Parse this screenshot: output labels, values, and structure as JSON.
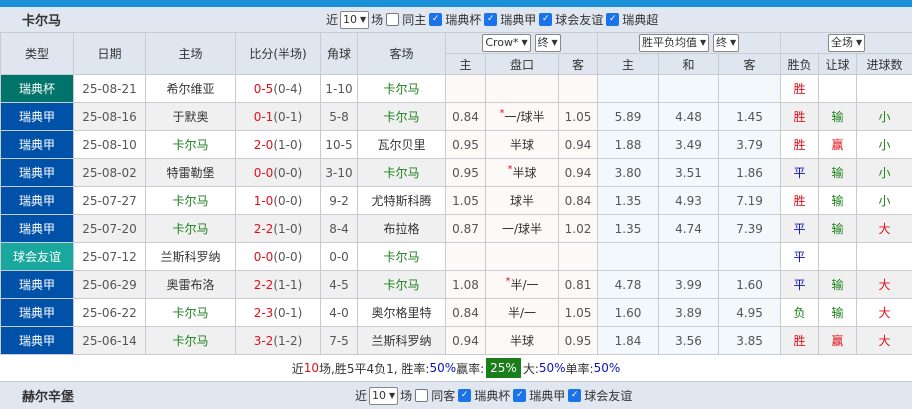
{
  "home_team": {
    "name": "卡尔马",
    "filter": {
      "near": "近",
      "count": "10",
      "unit": "场",
      "same": "同主",
      "leagues": [
        "瑞典杯",
        "瑞典甲",
        "球会友谊",
        "瑞典超"
      ]
    }
  },
  "headers": {
    "type": "类型",
    "date": "日期",
    "home": "主场",
    "score": "比分(半场)",
    "corner": "角球",
    "away": "客场",
    "company": "Crow*",
    "final1": "终",
    "odds_type": "胜平负均值",
    "final2": "终",
    "scope": "全场",
    "sub": [
      "主",
      "盘口",
      "客",
      "主",
      "和",
      "客",
      "胜负",
      "让球",
      "进球数"
    ]
  },
  "league_colors": {
    "瑞典杯": "#00736a",
    "瑞典甲": "#0051a8",
    "球会友谊": "#1aa89e"
  },
  "rows": [
    {
      "league": "瑞典杯",
      "date": "25-08-21",
      "home": "希尔维亚",
      "home_hl": false,
      "ft": "0-5",
      "ht": "(0-4)",
      "corner": "1-10",
      "away": "卡尔马",
      "away_hl": true,
      "ah_h": "",
      "ah": "",
      "ah_star": false,
      "ah_a": "",
      "w": "",
      "d": "",
      "l": "",
      "res": "胜",
      "hc": "",
      "ou": ""
    },
    {
      "league": "瑞典甲",
      "date": "25-08-16",
      "home": "于默奥",
      "home_hl": false,
      "ft": "0-1",
      "ht": "(0-1)",
      "corner": "5-8",
      "away": "卡尔马",
      "away_hl": true,
      "ah_h": "0.84",
      "ah": "一/球半",
      "ah_star": true,
      "ah_a": "1.05",
      "w": "5.89",
      "d": "4.48",
      "l": "1.45",
      "res": "胜",
      "hc": "输",
      "ou": "小"
    },
    {
      "league": "瑞典甲",
      "date": "25-08-10",
      "home": "卡尔马",
      "home_hl": true,
      "ft": "2-0",
      "ht": "(1-0)",
      "corner": "10-5",
      "away": "瓦尔贝里",
      "away_hl": false,
      "ah_h": "0.95",
      "ah": "半球",
      "ah_star": false,
      "ah_a": "0.94",
      "w": "1.88",
      "d": "3.49",
      "l": "3.79",
      "res": "胜",
      "hc": "赢",
      "ou": "小"
    },
    {
      "league": "瑞典甲",
      "date": "25-08-02",
      "home": "特雷勒堡",
      "home_hl": false,
      "ft": "0-0",
      "ht": "(0-0)",
      "corner": "3-10",
      "away": "卡尔马",
      "away_hl": true,
      "ah_h": "0.95",
      "ah": "半球",
      "ah_star": true,
      "ah_a": "0.94",
      "w": "3.80",
      "d": "3.51",
      "l": "1.86",
      "res": "平",
      "hc": "输",
      "ou": "小"
    },
    {
      "league": "瑞典甲",
      "date": "25-07-27",
      "home": "卡尔马",
      "home_hl": true,
      "ft": "1-0",
      "ht": "(0-0)",
      "corner": "9-2",
      "away": "尤特斯科腾",
      "away_hl": false,
      "ah_h": "1.05",
      "ah": "球半",
      "ah_star": false,
      "ah_a": "0.84",
      "w": "1.35",
      "d": "4.93",
      "l": "7.19",
      "res": "胜",
      "hc": "输",
      "ou": "小"
    },
    {
      "league": "瑞典甲",
      "date": "25-07-20",
      "home": "卡尔马",
      "home_hl": true,
      "ft": "2-2",
      "ht": "(1-0)",
      "corner": "8-4",
      "away": "布拉格",
      "away_hl": false,
      "ah_h": "0.87",
      "ah": "一/球半",
      "ah_star": false,
      "ah_a": "1.02",
      "w": "1.35",
      "d": "4.74",
      "l": "7.39",
      "res": "平",
      "hc": "输",
      "ou": "大"
    },
    {
      "league": "球会友谊",
      "date": "25-07-12",
      "home": "兰斯科罗纳",
      "home_hl": false,
      "ft": "0-0",
      "ht": "(0-0)",
      "corner": "0-0",
      "away": "卡尔马",
      "away_hl": true,
      "ah_h": "",
      "ah": "",
      "ah_star": false,
      "ah_a": "",
      "w": "",
      "d": "",
      "l": "",
      "res": "平",
      "hc": "",
      "ou": ""
    },
    {
      "league": "瑞典甲",
      "date": "25-06-29",
      "home": "奥雷布洛",
      "home_hl": false,
      "ft": "2-2",
      "ht": "(1-1)",
      "corner": "4-5",
      "away": "卡尔马",
      "away_hl": true,
      "ah_h": "1.08",
      "ah": "半/一",
      "ah_star": true,
      "ah_a": "0.81",
      "w": "4.78",
      "d": "3.99",
      "l": "1.60",
      "res": "平",
      "hc": "输",
      "ou": "大"
    },
    {
      "league": "瑞典甲",
      "date": "25-06-22",
      "home": "卡尔马",
      "home_hl": true,
      "ft": "2-3",
      "ht": "(0-1)",
      "corner": "4-0",
      "away": "奥尔格里特",
      "away_hl": false,
      "ah_h": "0.84",
      "ah": "半/一",
      "ah_star": false,
      "ah_a": "1.05",
      "w": "1.60",
      "d": "3.89",
      "l": "4.95",
      "res": "负",
      "hc": "输",
      "ou": "大"
    },
    {
      "league": "瑞典甲",
      "date": "25-06-14",
      "home": "卡尔马",
      "home_hl": true,
      "ft": "3-2",
      "ht": "(1-2)",
      "corner": "7-5",
      "away": "兰斯科罗纳",
      "away_hl": false,
      "ah_h": "0.94",
      "ah": "半球",
      "ah_star": false,
      "ah_a": "0.95",
      "w": "1.84",
      "d": "3.56",
      "l": "3.85",
      "res": "胜",
      "hc": "赢",
      "ou": "大"
    }
  ],
  "summary": {
    "p1": "近",
    "n": "10",
    "p2": "场,胜5平4负1, 胜率:",
    "win_rate": "50%",
    "p3": " 赢率:",
    "cover_rate": "25%",
    "p4": " 大:",
    "over_rate": "50%",
    "p5": " 单率:",
    "odd_rate": "50%"
  },
  "away_team": {
    "name": "赫尔辛堡",
    "filter": {
      "near": "近",
      "count": "10",
      "unit": "场",
      "same": "同客",
      "leagues": [
        "瑞典杯",
        "瑞典甲",
        "球会友谊"
      ]
    }
  }
}
